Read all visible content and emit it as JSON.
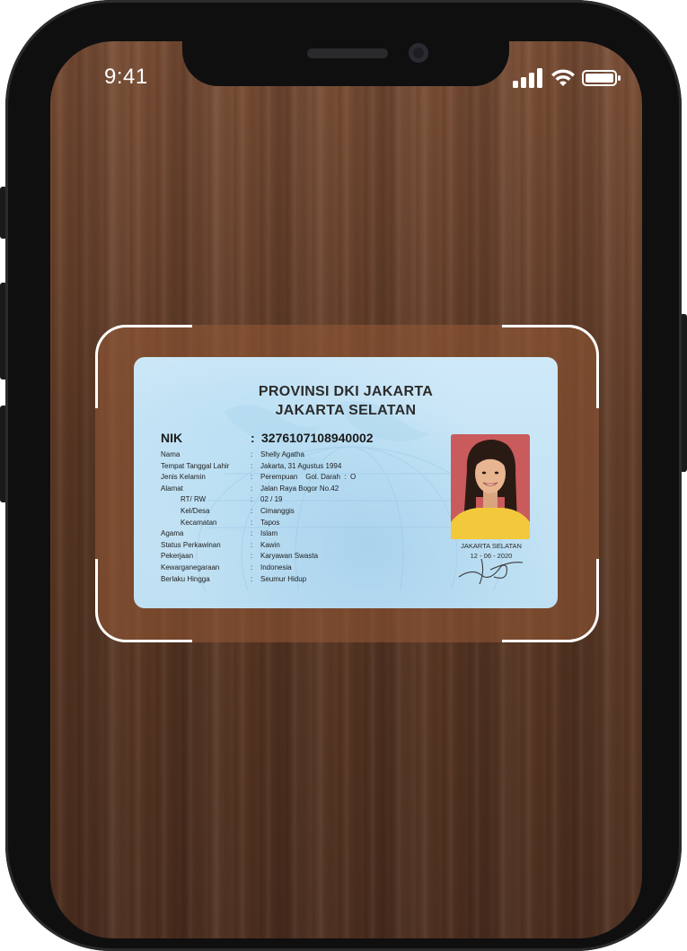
{
  "status_bar": {
    "time": "9:41",
    "icons": [
      "cellular-signal-icon",
      "wifi-icon",
      "battery-icon"
    ]
  },
  "id_card": {
    "title_line1": "PROVINSI DKI JAKARTA",
    "title_line2": "JAKARTA SELATAN",
    "nik_label": "NIK",
    "nik_value": "3276107108940002",
    "separator": ":",
    "fields": [
      {
        "label": "Nama",
        "value": "Shelly Agatha"
      },
      {
        "label": "Tempat Tanggal Lahir",
        "value": "Jakarta, 31 Agustus 1994"
      },
      {
        "label": "Jenis Kelamin",
        "value": "Perempuan    Gol. Darah  :  O"
      },
      {
        "label": "Alamat",
        "value": "Jalan Raya Bogor No.42"
      },
      {
        "label": "RT/ RW",
        "value": "02 / 19",
        "indent": true
      },
      {
        "label": "Kel/Desa",
        "value": "Cimanggis",
        "indent": true
      },
      {
        "label": "Kecamatan",
        "value": "Tapos",
        "indent": true
      },
      {
        "label": "Agama",
        "value": "Islam"
      },
      {
        "label": "Status Perkawinan",
        "value": "Kawin"
      },
      {
        "label": "Pekerjaan",
        "value": "Karyawan Swasta"
      },
      {
        "label": "Kewarganegaraan",
        "value": "Indonesia"
      },
      {
        "label": "Berlaku Hingga",
        "value": "Seumur Hidup"
      }
    ],
    "issue_place": "JAKARTA SELATAN",
    "issue_date": "12 - 06 - 2020",
    "photo_bg_color": "#c95b5c"
  },
  "colors": {
    "scan_frame": "#ffffff",
    "card_bg": "#c4e3f5",
    "wood_bg": "#5e3a26"
  }
}
